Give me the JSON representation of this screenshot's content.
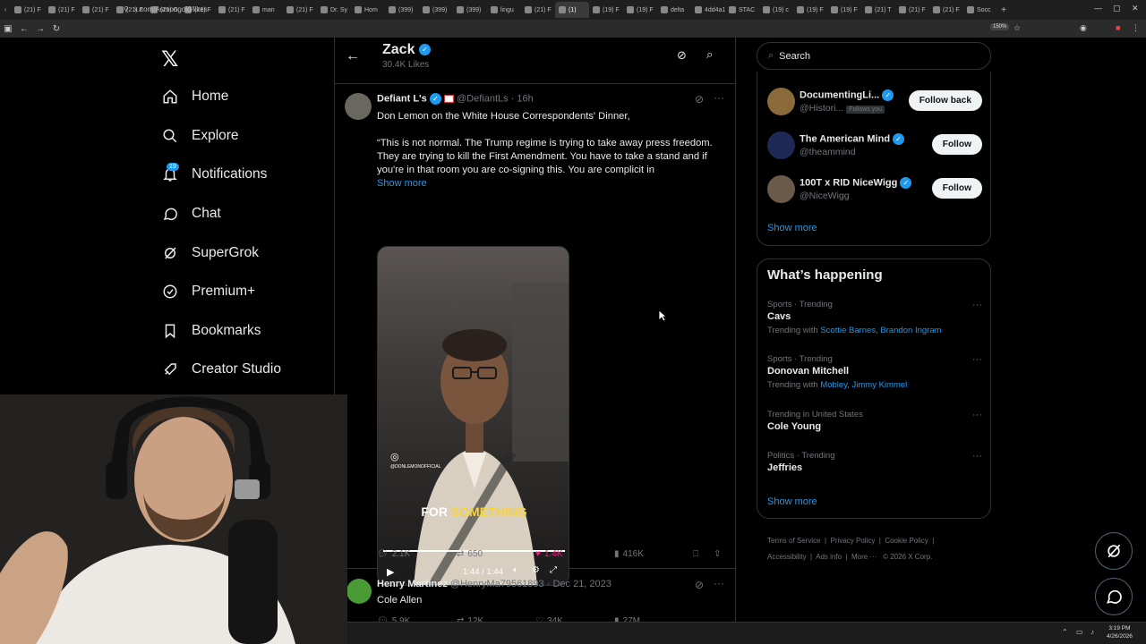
{
  "browser": {
    "tabs": [
      "(21) F",
      "(21) F",
      "(21) F",
      "(21) F",
      "(21) G",
      "(21) F",
      "(21) F",
      "man",
      "(21) F",
      "Dr. Sy",
      "Hom",
      "(399)",
      "(399)",
      "(399)",
      "lingu",
      "(21) F",
      "(1) ",
      "(19) F",
      "(19) F",
      "delta",
      "4dd4a14",
      "STAC",
      "(19) c",
      "(19) F",
      "(19) F",
      "(21) T",
      "(21) F",
      "(21) F",
      "Socc"
    ],
    "active_tab_index": 16,
    "url": "x.com/Asmongold/likes",
    "zoom": "150%"
  },
  "nav": {
    "items": [
      {
        "label": "Home",
        "icon": "home-icon"
      },
      {
        "label": "Explore",
        "icon": "search-icon"
      },
      {
        "label": "Notifications",
        "icon": "bell-icon"
      },
      {
        "label": "Chat",
        "icon": "chat-icon"
      },
      {
        "label": "SuperGrok",
        "icon": "grok-icon"
      },
      {
        "label": "Premium+",
        "icon": "verified-icon"
      },
      {
        "label": "Bookmarks",
        "icon": "bookmark-icon"
      },
      {
        "label": "Creator Studio",
        "icon": "rocket-icon"
      }
    ],
    "notifications_badge": "19"
  },
  "header": {
    "name": "Zack",
    "likes": "30.4K Likes"
  },
  "tweet1": {
    "name": "Defiant L's",
    "handle": "@DefiantLs",
    "time": "16h",
    "line1": "Don Lemon on the White House Correspondents' Dinner,",
    "quote": "“This is not normal. The Trump regime is trying to take away press freedom. They are trying to kill the First Amendment. You have to take a stand and if you're in that room you are co-signing this. You are complicit in",
    "show_more": "Show more",
    "video_watermark": "@DONLEMONOFFICIAL",
    "caption_word1": "FOR",
    "caption_word2": "SOMETHING",
    "video_time": "1:44 / 1:44",
    "video_progress": 1.0,
    "replies": "2.1K",
    "reposts": "650",
    "likes": "1.4K",
    "views": "416K"
  },
  "tweet2": {
    "name": "Henry Martinez",
    "handle": "@HenryMa79561893",
    "time": "Dec 21, 2023",
    "text": "Cole Allen",
    "replies": "5.9K",
    "reposts": "12K",
    "likes": "34K",
    "views": "27M"
  },
  "sidebar": {
    "search_placeholder": "Search",
    "who_to_follow": [
      {
        "name": "DocumentingLi...",
        "handle": "@Histori...",
        "badge": "Follows you",
        "button": "Follow back",
        "color": "#8a6a3a"
      },
      {
        "name": "The American Mind",
        "handle": "@theammind",
        "badge": "",
        "button": "Follow",
        "color": "#1e2a55"
      },
      {
        "name": "100T x RID NiceWigg",
        "handle": "@NiceWigg",
        "badge": "",
        "button": "Follow",
        "color": "#6b5a4a"
      }
    ],
    "show_more_follow": "Show more",
    "happening_title": "What’s happening",
    "trends": [
      {
        "category": "Sports · Trending",
        "title": "Cavs",
        "with_prefix": "Trending with",
        "with": "Scottie Barnes, Brandon Ingram"
      },
      {
        "category": "Sports · Trending",
        "title": "Donovan Mitchell",
        "with_prefix": "Trending with",
        "with": "Mobley, Jimmy Kimmel"
      },
      {
        "category": "Trending in United States",
        "title": "Cole Young",
        "with_prefix": "",
        "with": ""
      },
      {
        "category": "Politics · Trending",
        "title": "Jeffries",
        "with_prefix": "",
        "with": ""
      }
    ],
    "show_more_trends": "Show more",
    "footer": {
      "terms": "Terms of Service",
      "privacy": "Privacy Policy",
      "cookie": "Cookie Policy",
      "accessibility": "Accessibility",
      "ads": "Ads info",
      "more": "More ···",
      "copyright": "© 2026 X Corp."
    }
  },
  "taskbar": {
    "time": "3:19 PM",
    "date": "4/26/2026"
  },
  "colors": {
    "accent": "#1d9bf0",
    "like": "#f91880",
    "border": "#2f3336"
  }
}
